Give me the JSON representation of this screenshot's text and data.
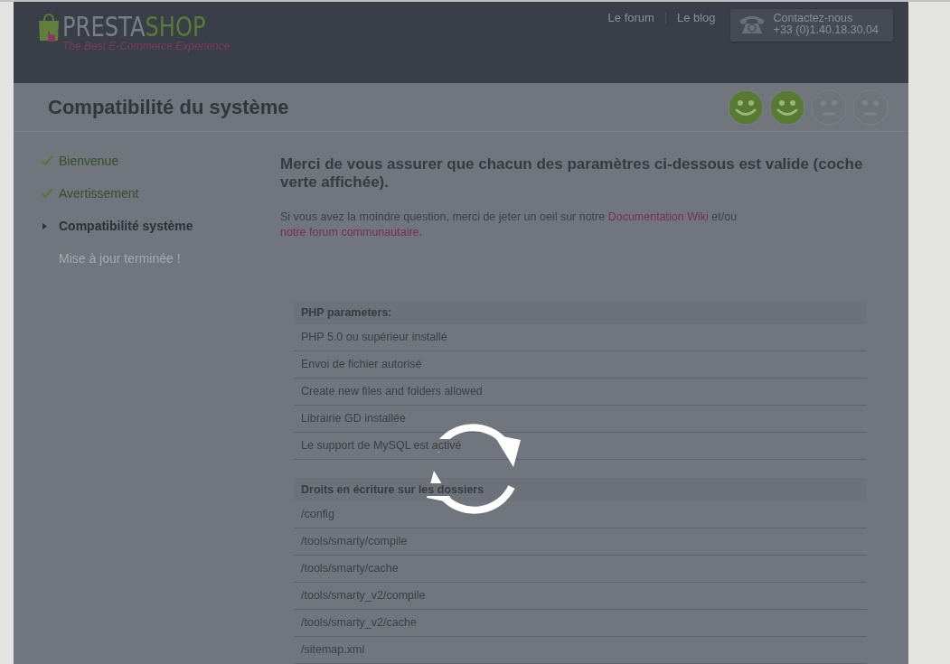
{
  "header": {
    "logo": {
      "brand_left": "PRESTA",
      "brand_right": "SHOP",
      "tagline": "The Best E-Commerce Experience"
    },
    "links": [
      "Le forum",
      "Le blog"
    ],
    "contact": {
      "label": "Contactez-nous",
      "phone": "+33 (0)1.40.18.30.04"
    }
  },
  "title_bar": {
    "title": "Compatibilité du système",
    "progress": [
      {
        "done": true
      },
      {
        "done": true
      },
      {
        "done": false
      },
      {
        "done": false
      }
    ]
  },
  "sidebar": {
    "items": [
      {
        "label": "Bienvenue",
        "checked": true,
        "selected": false
      },
      {
        "label": "Avertissement",
        "checked": true,
        "selected": false
      },
      {
        "label": "Compatibilité système",
        "checked": false,
        "selected": true
      },
      {
        "label": "Mise à jour terminée !",
        "checked": false,
        "selected": false
      }
    ]
  },
  "content": {
    "heading": "Merci de vous assurer que chacun des paramètres ci-dessous est valide (coche verte affichée).",
    "intro": {
      "before": "Si vous avez la moindre question, merci de jeter un oeil sur notre",
      "link_1": "Documentation Wiki",
      "between": "et/ou",
      "link_2": "notre forum communautaire",
      "after": "."
    },
    "sections": [
      {
        "title": "PHP parameters:",
        "rows": [
          "PHP 5.0 ou supérieur installé",
          "Envoi de fichier autorisé",
          "Create new files and folders allowed",
          "Librairie GD installée",
          "Le support de MySQL est activé"
        ]
      },
      {
        "title": "Droits en écriture sur les dossiers",
        "rows": [
          "/config",
          "/tools/smarty/compile",
          "/tools/smarty/cache",
          "/tools/smarty_v2/compile",
          "/tools/smarty_v2/cache",
          "/sitemap.xml"
        ]
      }
    ]
  }
}
